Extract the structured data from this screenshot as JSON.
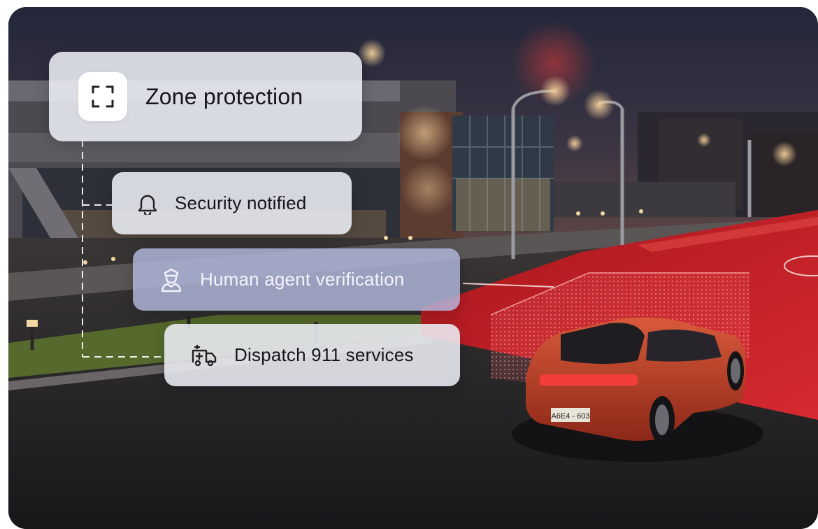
{
  "steps": {
    "zone": {
      "label": "Zone protection",
      "icon": "scan-frame-icon"
    },
    "security": {
      "label": "Security notified",
      "icon": "bell-icon"
    },
    "agent": {
      "label": "Human agent verification",
      "icon": "security-guard-icon"
    },
    "dispatch": {
      "label": "Dispatch 911 services",
      "icon": "ambulance-icon"
    }
  },
  "scene": {
    "license_plate": "A6E4 - 603"
  },
  "colors": {
    "zone_red": "#c8202a",
    "card_bg": "#eceef5",
    "agent_card_bg": "#b2b8de",
    "text_dark": "#15161c"
  }
}
